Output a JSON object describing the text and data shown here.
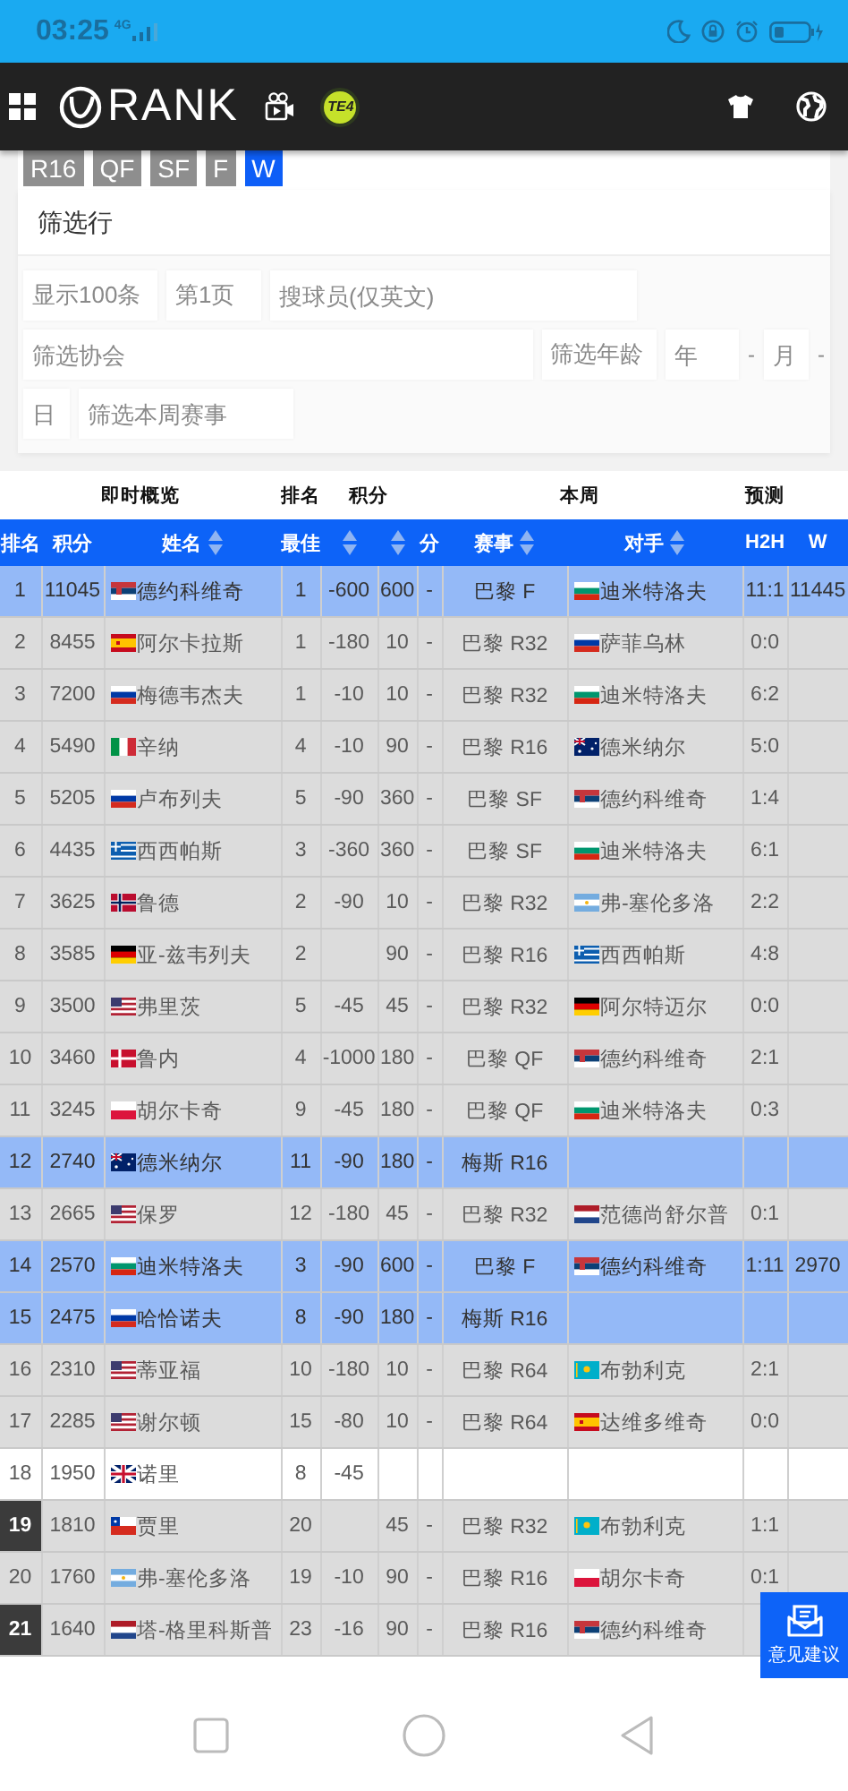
{
  "status_bar": {
    "time": "03:25",
    "network": "4G"
  },
  "header": {
    "logo": "RANK",
    "badge": "TE4"
  },
  "rounds": [
    {
      "label": "R16",
      "selected": false
    },
    {
      "label": "QF",
      "selected": false
    },
    {
      "label": "SF",
      "selected": false
    },
    {
      "label": "F",
      "selected": false
    },
    {
      "label": "W",
      "selected": true
    }
  ],
  "filters": {
    "title": "筛选行",
    "field_rows": [
      [
        {
          "kind": "select",
          "value": "显示100条"
        },
        {
          "kind": "select",
          "value": "第1页"
        },
        {
          "kind": "input",
          "placeholder": "搜球员(仅英文)"
        }
      ],
      [
        {
          "kind": "input",
          "placeholder": "筛选协会"
        },
        {
          "kind": "label",
          "text": "筛选年龄"
        },
        {
          "kind": "select",
          "placeholder": "年"
        },
        {
          "kind": "sep",
          "text": "-"
        },
        {
          "kind": "select",
          "placeholder": "月"
        },
        {
          "kind": "sep",
          "text": "-"
        }
      ],
      [
        {
          "kind": "select",
          "placeholder": "日"
        },
        {
          "kind": "select",
          "placeholder": "筛选本周赛事"
        }
      ]
    ]
  },
  "table": {
    "groups": [
      "即时概览",
      "排名",
      "积分",
      "本周",
      "预测"
    ],
    "columns": [
      {
        "label": "排名",
        "sortable": false
      },
      {
        "label": "积分",
        "sortable": false
      },
      {
        "label": "姓名",
        "sortable": true
      },
      {
        "label": "最佳",
        "sortable": false
      },
      {
        "sortable": true
      },
      {
        "sortable": true
      },
      {
        "label": "分",
        "sortable": false
      },
      {
        "label": "赛事",
        "sortable": true
      },
      {
        "label": "对手",
        "sortable": true
      },
      {
        "label": "H2H",
        "sortable": false
      },
      {
        "label": "W",
        "sortable": false
      }
    ],
    "rows": [
      {
        "kind": "live",
        "marked": false,
        "rank": "1",
        "points": "11045",
        "name": "德约科维奇",
        "best": "1",
        "minus": "-600",
        "plus": "600",
        "score": "-",
        "event": "巴黎 F",
        "opponent": "迪米特洛夫",
        "h2h": "11:1",
        "w": "11445"
      },
      {
        "kind": "normal",
        "marked": false,
        "rank": "2",
        "points": "8455",
        "name": "阿尔卡拉斯",
        "best": "1",
        "minus": "-180",
        "plus": "10",
        "score": "-",
        "event": "巴黎 R32",
        "opponent": "萨菲乌林",
        "h2h": "0:0"
      },
      {
        "kind": "normal",
        "marked": false,
        "rank": "3",
        "points": "7200",
        "name": "梅德韦杰夫",
        "best": "1",
        "minus": "-10",
        "plus": "10",
        "score": "-",
        "event": "巴黎 R32",
        "opponent": "迪米特洛夫",
        "h2h": "6:2"
      },
      {
        "kind": "normal",
        "marked": false,
        "rank": "4",
        "points": "5490",
        "name": "辛纳",
        "best": "4",
        "minus": "-10",
        "plus": "90",
        "score": "-",
        "event": "巴黎 R16",
        "opponent": "德米纳尔",
        "h2h": "5:0"
      },
      {
        "kind": "normal",
        "marked": false,
        "rank": "5",
        "points": "5205",
        "name": "卢布列夫",
        "best": "5",
        "minus": "-90",
        "plus": "360",
        "score": "-",
        "event": "巴黎 SF",
        "opponent": "德约科维奇",
        "h2h": "1:4"
      },
      {
        "kind": "normal",
        "marked": false,
        "rank": "6",
        "points": "4435",
        "name": "西西帕斯",
        "best": "3",
        "minus": "-360",
        "plus": "360",
        "score": "-",
        "event": "巴黎 SF",
        "opponent": "迪米特洛夫",
        "h2h": "6:1"
      },
      {
        "kind": "normal",
        "marked": false,
        "rank": "7",
        "points": "3625",
        "name": "鲁德",
        "best": "2",
        "minus": "-90",
        "plus": "10",
        "score": "-",
        "event": "巴黎 R32",
        "opponent": "弗-塞伦多洛",
        "h2h": "2:2"
      },
      {
        "kind": "normal",
        "marked": false,
        "rank": "8",
        "points": "3585",
        "name": "亚-兹韦列夫",
        "best": "2",
        "plus": "90",
        "score": "-",
        "event": "巴黎 R16",
        "opponent": "西西帕斯",
        "h2h": "4:8"
      },
      {
        "kind": "normal",
        "marked": false,
        "rank": "9",
        "points": "3500",
        "name": "弗里茨",
        "best": "5",
        "minus": "-45",
        "plus": "45",
        "score": "-",
        "event": "巴黎 R32",
        "opponent": "阿尔特迈尔",
        "h2h": "0:0"
      },
      {
        "kind": "normal",
        "marked": false,
        "rank": "10",
        "points": "3460",
        "name": "鲁内",
        "best": "4",
        "minus": "-1000",
        "plus": "180",
        "score": "-",
        "event": "巴黎 QF",
        "opponent": "德约科维奇",
        "h2h": "2:1"
      },
      {
        "kind": "normal",
        "marked": false,
        "rank": "11",
        "points": "3245",
        "name": "胡尔卡奇",
        "best": "9",
        "minus": "-45",
        "plus": "180",
        "score": "-",
        "event": "巴黎 QF",
        "opponent": "迪米特洛夫",
        "h2h": "0:3"
      },
      {
        "kind": "live",
        "marked": false,
        "rank": "12",
        "points": "2740",
        "name": "德米纳尔",
        "best": "11",
        "minus": "-90",
        "plus": "180",
        "score": "-",
        "event": "梅斯 R16"
      },
      {
        "kind": "normal",
        "marked": false,
        "rank": "13",
        "points": "2665",
        "name": "保罗",
        "best": "12",
        "minus": "-180",
        "plus": "45",
        "score": "-",
        "event": "巴黎 R32",
        "opponent": "范德尚舒尔普",
        "h2h": "0:1"
      },
      {
        "kind": "live",
        "marked": false,
        "rank": "14",
        "points": "2570",
        "name": "迪米特洛夫",
        "best": "3",
        "minus": "-90",
        "plus": "600",
        "score": "-",
        "event": "巴黎 F",
        "opponent": "德约科维奇",
        "h2h": "1:11",
        "w": "2970"
      },
      {
        "kind": "live",
        "marked": false,
        "rank": "15",
        "points": "2475",
        "name": "哈恰诺夫",
        "best": "8",
        "minus": "-90",
        "plus": "180",
        "score": "-",
        "event": "梅斯 R16"
      },
      {
        "kind": "normal",
        "marked": false,
        "rank": "16",
        "points": "2310",
        "name": "蒂亚福",
        "best": "10",
        "minus": "-180",
        "plus": "10",
        "score": "-",
        "event": "巴黎 R64",
        "opponent": "布勃利克",
        "h2h": "2:1"
      },
      {
        "kind": "normal",
        "marked": false,
        "rank": "17",
        "points": "2285",
        "name": "谢尔顿",
        "best": "15",
        "minus": "-80",
        "plus": "10",
        "score": "-",
        "event": "巴黎 R64",
        "opponent": "达维多维奇",
        "h2h": "0:0"
      },
      {
        "kind": "out",
        "marked": false,
        "rank": "18",
        "points": "1950",
        "name": "诺里",
        "best": "8",
        "minus": "-45"
      },
      {
        "kind": "normal",
        "marked": true,
        "rank": "19",
        "points": "1810",
        "name": "贾里",
        "best": "20",
        "plus": "45",
        "score": "-",
        "event": "巴黎 R32",
        "opponent": "布勃利克",
        "h2h": "1:1"
      },
      {
        "kind": "normal",
        "marked": false,
        "rank": "20",
        "points": "1760",
        "name": "弗-塞伦多洛",
        "best": "19",
        "minus": "-10",
        "plus": "90",
        "score": "-",
        "event": "巴黎 R16",
        "opponent": "胡尔卡奇",
        "h2h": "0:1"
      },
      {
        "kind": "normal",
        "marked": true,
        "rank": "21",
        "points": "1640",
        "name": "塔-格里科斯普",
        "best": "23",
        "minus": "-16",
        "plus": "90",
        "score": "-",
        "event": "巴黎 R16",
        "opponent": "德约科维奇"
      }
    ]
  },
  "feedback": {
    "label": "意见建议"
  }
}
